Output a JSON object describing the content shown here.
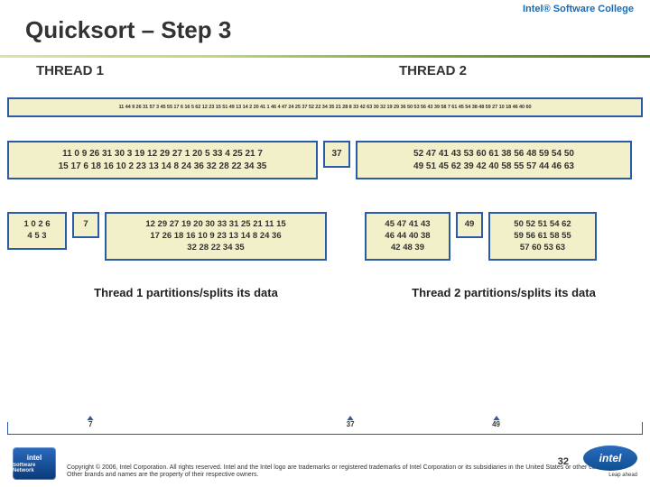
{
  "header": {
    "college": "Intel® Software College",
    "title": "Quicksort – Step 3"
  },
  "threads": {
    "t1": "THREAD 1",
    "t2": "THREAD 2"
  },
  "fullrow": "11 44 9 26 31 57 3 45 55 17 6 16 5 62 12 23 15 51 49 13 14 2 20 41 1 46 4 47 24 25 37 52 22 34 35 21 28 8 33 42 63 30 32 19 29 36 50 53 56 43 39 58 7 61 45 54 38 48 59 27 10 18 46 40 60",
  "row1": {
    "left": "11 0 9 26 31 30 3 19 12 29 27 1 20 5 33 4 25 21 7\n15 17 6 18 16 10 2 23 13 14 8 24 36 32 28 22 34 35",
    "pivot": "37",
    "right": "52 47 41 43 53 60 61 38 56 48 59 54 50\n49 51 45 62 39 42 40 58 55 57 44 46 63"
  },
  "row2": {
    "b1": "1 0 2 6\n4 5 3",
    "p1": "7",
    "b2": "12 29 27 19 20 30 33 31 25 21 11 15\n17 26 18 16 10 9 23 13 14 8 24 36\n32 28 22 34 35",
    "b3": "45 47 41 43\n46 44 40 38\n42 48 39",
    "p2": "49",
    "b4": "50 52 51 54 62\n59 56 61 58 55\n57 60 53 63"
  },
  "captions": {
    "c1": "Thread 1\npartitions/splits its data",
    "c2": "Thread 2\npartitions/splits its data"
  },
  "arrow": {
    "aLabel": "7",
    "bLabel": "37",
    "cLabel": "49"
  },
  "footer": {
    "chip_brand": "intel",
    "chip_sub": "Software Network",
    "copy": "Copyright © 2006, Intel Corporation. All rights reserved.\nIntel and the Intel logo are trademarks or registered trademarks of Intel Corporation or its subsidiaries in the United States\nor other countries. * Other brands and names are the property of their respective owners.",
    "slidenum": "32",
    "logo_text": "intel",
    "leap": "Leap ahead"
  }
}
